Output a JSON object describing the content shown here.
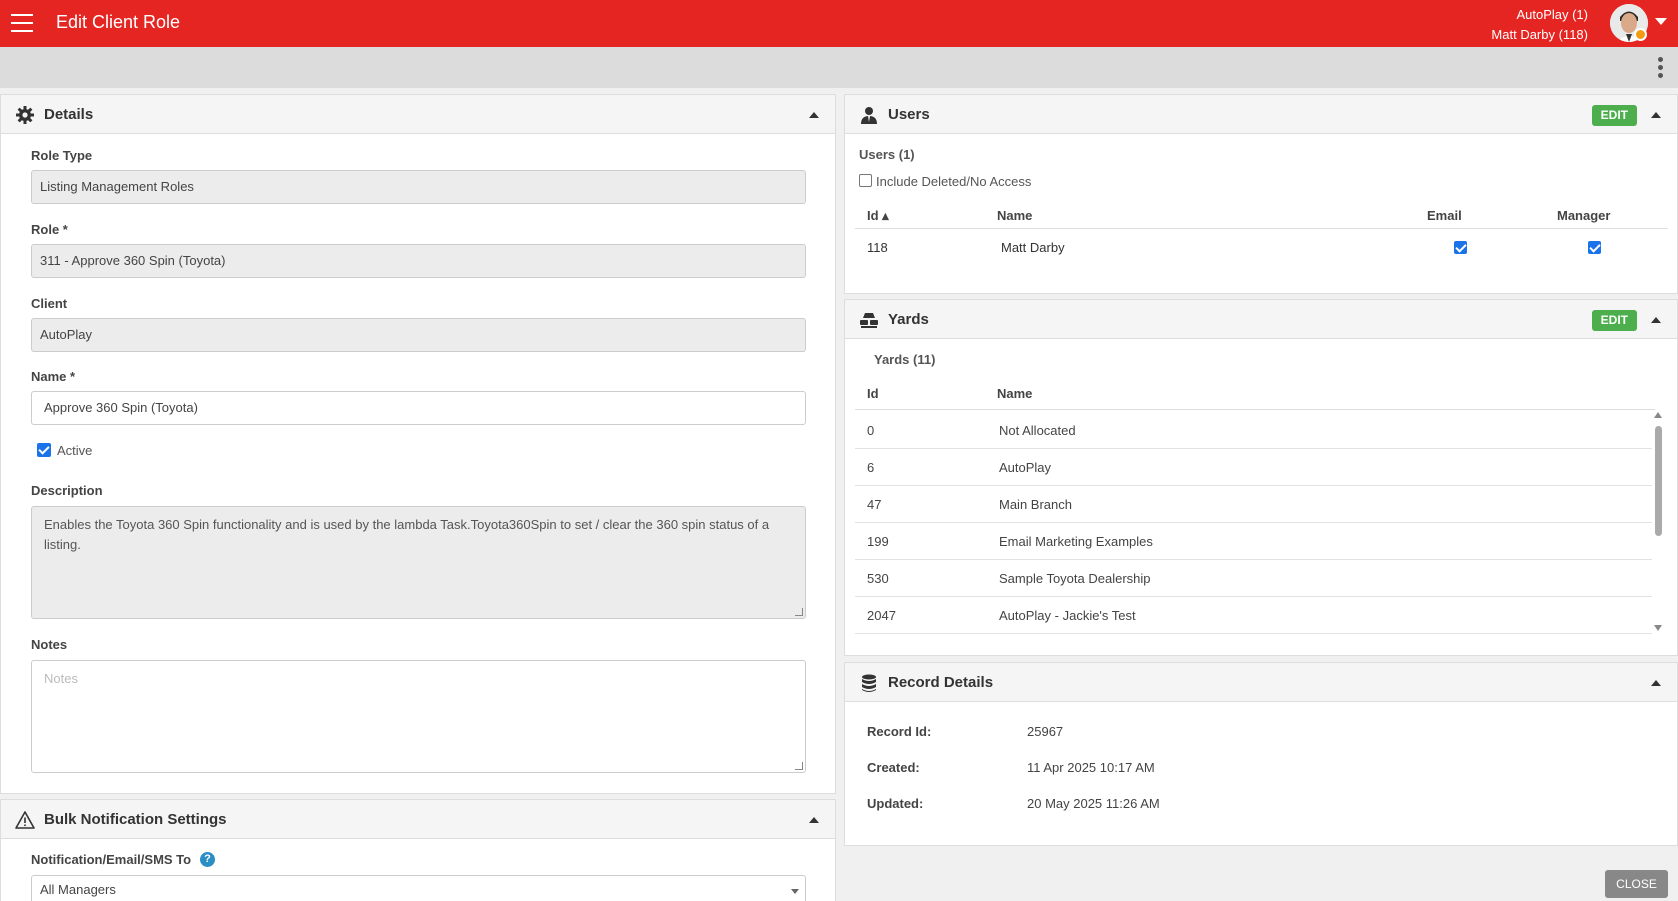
{
  "header": {
    "title": "Edit Client Role",
    "client_line": "AutoPlay (1)",
    "user_line": "Matt Darby (118)"
  },
  "colors": {
    "brand_red": "#e52521",
    "edit_green": "#4cae4c",
    "check_blue": "#1a73e8",
    "help_blue": "#2b8fc6"
  },
  "details": {
    "title": "Details",
    "role_type_label": "Role Type",
    "role_type_value": "Listing Management Roles",
    "role_label": "Role *",
    "role_value": "311 - Approve 360 Spin (Toyota)",
    "client_label": "Client",
    "client_value": "AutoPlay",
    "name_label": "Name *",
    "name_value": "Approve 360 Spin (Toyota)",
    "active_label": "Active",
    "active_checked": true,
    "description_label": "Description",
    "description_value": "Enables the Toyota 360 Spin functionality and is used by the lambda Task.Toyota360Spin to set / clear the 360 spin status of a listing.",
    "notes_label": "Notes",
    "notes_placeholder": "Notes"
  },
  "bulk": {
    "title": "Bulk Notification Settings",
    "notify_label": "Notification/Email/SMS To",
    "notify_value": "All Managers",
    "help_glyph": "?"
  },
  "users": {
    "title": "Users",
    "edit_label": "EDIT",
    "count_label": "Users (1)",
    "include_deleted_label": "Include Deleted/No Access",
    "columns": {
      "id": "Id ▴",
      "name": "Name",
      "email": "Email",
      "manager": "Manager"
    },
    "rows": [
      {
        "id": "118",
        "name": "Matt Darby",
        "email": true,
        "manager": true
      }
    ]
  },
  "yards": {
    "title": "Yards",
    "edit_label": "EDIT",
    "count_label": "Yards (11)",
    "columns": {
      "id": "Id",
      "name": "Name"
    },
    "rows": [
      {
        "id": "0",
        "name": "Not Allocated"
      },
      {
        "id": "6",
        "name": "AutoPlay"
      },
      {
        "id": "47",
        "name": "Main Branch"
      },
      {
        "id": "199",
        "name": "Email Marketing Examples"
      },
      {
        "id": "530",
        "name": "Sample Toyota Dealership"
      },
      {
        "id": "2047",
        "name": "AutoPlay - Jackie's Test"
      }
    ]
  },
  "record": {
    "title": "Record Details",
    "id_label": "Record Id:",
    "id_value": "25967",
    "created_label": "Created:",
    "created_value": "11 Apr 2025 10:17 AM",
    "updated_label": "Updated:",
    "updated_value": "20 May 2025 11:26 AM"
  },
  "footer": {
    "close_label": "CLOSE"
  }
}
